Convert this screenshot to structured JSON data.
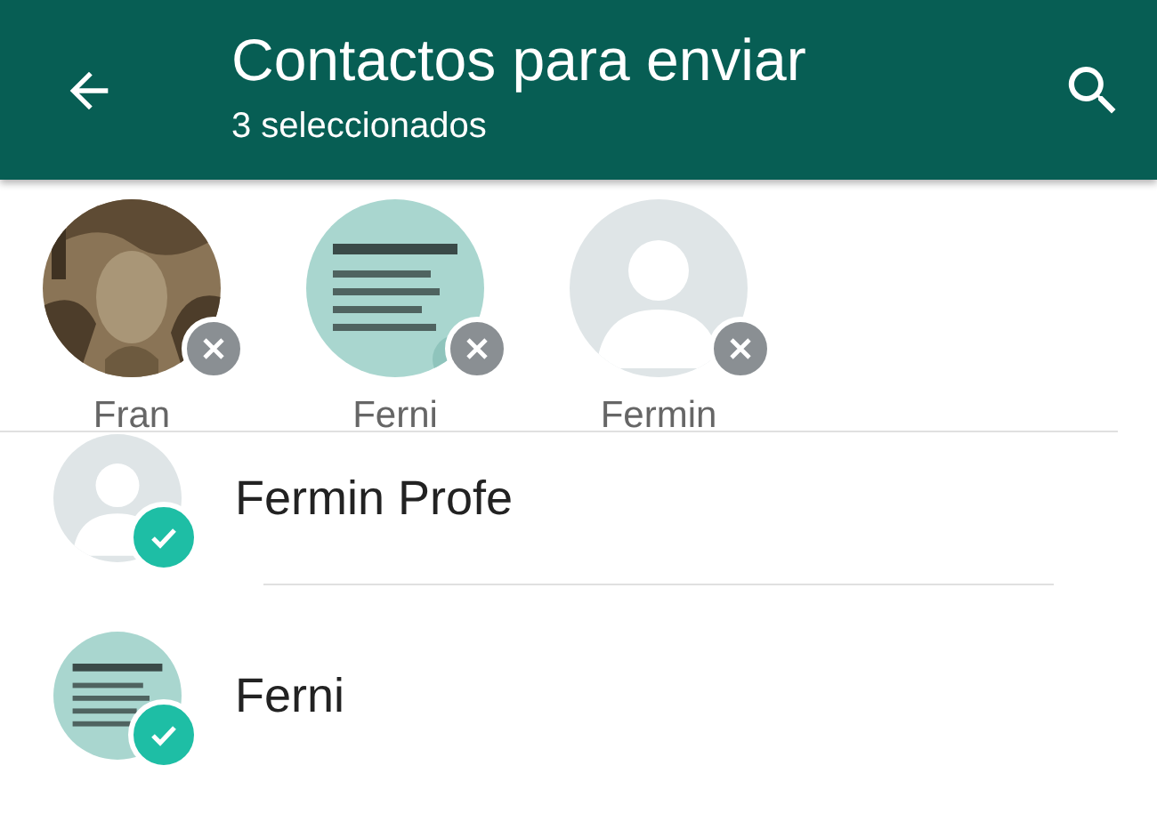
{
  "header": {
    "title": "Contactos para enviar",
    "subtitle": "3 seleccionados"
  },
  "selected": [
    {
      "name": "Fran"
    },
    {
      "name": "Ferni"
    },
    {
      "name": "Fermin",
      "kind": "placeholder"
    }
  ],
  "contacts": [
    {
      "name": "Fermin Profe",
      "kind": "placeholder",
      "checked": true
    },
    {
      "name": "Ferni",
      "checked": true
    }
  ]
}
